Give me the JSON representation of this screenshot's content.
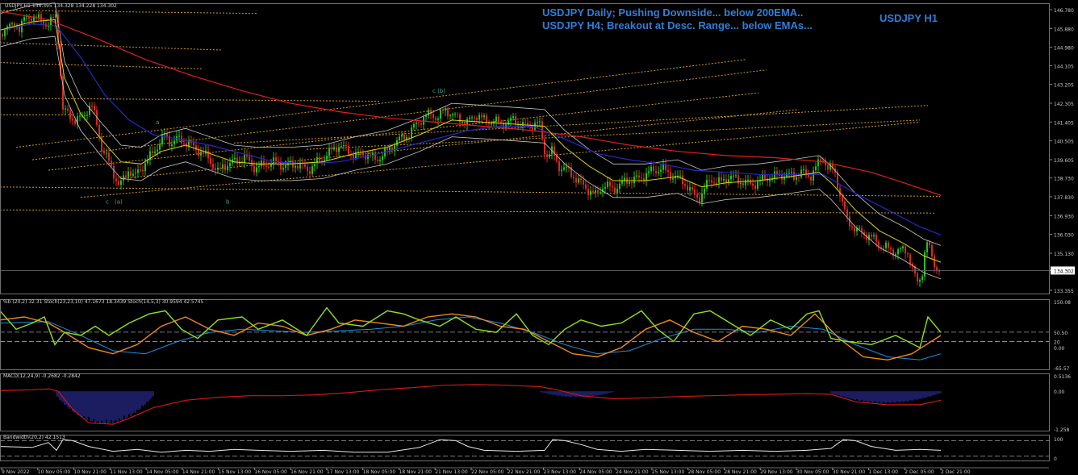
{
  "header": {
    "headline_1": "USDJPY Daily; Pushing Downside... below 200EMA..",
    "headline_2": "USDJPY H4; Breakout at Desc. Range... below EMAs...",
    "symbol_title": "USDJPY H1"
  },
  "panes": {
    "main_info": "USDJPY,H1  134.395 134.328 134.228 134.302",
    "osc_info": "%b (20,2) 32.31  Stoch(23,23,10) 47.1673 18.3439  Stoch(14,5,3) 30.9594 42.5745",
    "macd_info": "MACD(12,24,9) -0.2682 -0.2842",
    "bw_info": "Bandwidth(20,2) 42.1513"
  },
  "colors": {
    "background": "#000000",
    "bull_candle": "#22c11a",
    "bear_candle": "#d42b1f",
    "ema200": "#e02020",
    "ema_blue": "#2828c8",
    "ema_yellow": "#d8d020",
    "bands": "#c8c8c8",
    "fib_lines": "#d09a1c",
    "lime": "#90e020",
    "orange": "#f08820",
    "osc_blue": "#2090e0",
    "macd_line": "#d01818",
    "macd_hist": "#3838c0",
    "wave_labels": "#30b0a0",
    "axis_text": "#c8c8c8",
    "current_price_bg": "#ffffff"
  },
  "chart_data": [
    {
      "type": "candlestick",
      "title": "USDJPY H1",
      "x_tick_labels": [
        "9 Nov 2022",
        "10 Nov 05:00",
        "10 Nov 21:00",
        "11 Nov 13:00",
        "14 Nov 05:00",
        "14 Nov 21:00",
        "15 Nov 13:00",
        "16 Nov 05:00",
        "16 Nov 21:00",
        "17 Nov 13:00",
        "18 Nov 05:00",
        "18 Nov 21:00",
        "21 Nov 13:00",
        "22 Nov 05:00",
        "22 Nov 21:00",
        "23 Nov 13:00",
        "24 Nov 05:00",
        "24 Nov 21:00",
        "25 Nov 13:00",
        "28 Nov 05:00",
        "28 Nov 21:00",
        "29 Nov 13:00",
        "30 Nov 05:00",
        "30 Nov 21:00",
        "1 Dec 13:00",
        "2 Dec 05:00",
        "2 Dec 21:00"
      ],
      "y_tick_labels": [
        "146.780",
        "145.880",
        "144.980",
        "144.105",
        "143.205",
        "142.305",
        "141.405",
        "140.505",
        "139.605",
        "138.730",
        "137.830",
        "136.930",
        "136.030",
        "135.130",
        "134.302",
        "133.355"
      ],
      "ylim": [
        133.355,
        146.78
      ],
      "current_price": 134.302,
      "price_path": {
        "x": [
          0,
          8,
          14,
          20,
          24,
          30,
          40,
          48,
          60,
          70,
          78,
          92,
          102,
          113,
          122,
          126,
          136,
          148,
          160,
          166,
          172,
          182,
          190,
          200,
          204,
          212,
          220,
          232,
          244,
          258,
          270,
          276,
          290,
          304,
          316,
          340,
          352,
          368,
          382,
          400,
          410,
          420,
          432,
          440,
          452,
          466,
          480,
          492,
          506,
          516,
          524,
          534,
          542,
          552,
          566,
          580,
          592,
          602,
          612,
          620,
          636,
          652,
          668,
          676,
          684,
          692,
          704,
          716,
          728,
          738,
          748,
          760,
          776,
          792,
          804,
          820,
          830,
          846,
          860,
          868,
          880,
          892,
          904,
          916,
          932,
          948,
          960,
          972,
          984,
          994,
          1004,
          1012,
          1020,
          1026,
          1034,
          1042,
          1050,
          1062,
          1076,
          1092,
          1108,
          1124,
          1136,
          1142,
          1148,
          1154,
          1160,
          1166
        ],
        "y": [
          145.6,
          146.0,
          145.9,
          146.2,
          145.9,
          146.3,
          146.5,
          146.3,
          146.1,
          146.5,
          142.0,
          141.5,
          141.6,
          142.3,
          141.0,
          140.2,
          139.4,
          138.3,
          139.2,
          138.7,
          139.1,
          139.5,
          140.0,
          140.5,
          140.8,
          140.4,
          140.6,
          140.4,
          140.1,
          139.7,
          139.0,
          139.3,
          139.5,
          139.7,
          139.2,
          139.5,
          139.3,
          139.4,
          139.1,
          139.7,
          140.0,
          140.3,
          140.0,
          139.8,
          139.9,
          139.6,
          140.0,
          140.5,
          140.8,
          141.3,
          141.6,
          141.8,
          141.6,
          142.0,
          141.6,
          141.4,
          141.8,
          141.4,
          141.5,
          141.3,
          141.5,
          141.2,
          141.4,
          139.8,
          140.0,
          139.3,
          139.1,
          138.6,
          138.2,
          137.9,
          138.4,
          138.2,
          138.6,
          138.7,
          139.0,
          139.2,
          138.9,
          138.6,
          137.9,
          137.8,
          138.7,
          138.5,
          138.8,
          138.6,
          138.4,
          138.7,
          138.8,
          138.9,
          138.8,
          139.0,
          138.8,
          139.3,
          139.7,
          139.2,
          139.1,
          137.8,
          136.7,
          136.2,
          136.0,
          135.5,
          135.2,
          135.3,
          133.7,
          134.0,
          135.7,
          135.1,
          134.4,
          134.3
        ]
      },
      "ema200": {
        "x": [
          0,
          60,
          120,
          180,
          240,
          300,
          360,
          420,
          480,
          540,
          600,
          660,
          720,
          780,
          840,
          900,
          960,
          1020,
          1080,
          1120,
          1166
        ],
        "y": [
          146.7,
          146.3,
          145.4,
          144.4,
          143.6,
          142.9,
          142.3,
          141.9,
          141.6,
          141.4,
          141.2,
          141.0,
          140.7,
          140.3,
          140.0,
          139.8,
          139.7,
          139.5,
          139.0,
          138.5,
          137.9
        ]
      },
      "ema_blue": {
        "x": [
          0,
          40,
          70,
          100,
          130,
          160,
          190,
          220,
          260,
          300,
          340,
          380,
          420,
          460,
          500,
          540,
          580,
          620,
          660,
          700,
          740,
          780,
          820,
          860,
          900,
          940,
          980,
          1020,
          1060,
          1100,
          1140,
          1166
        ],
        "y": [
          145.8,
          146.1,
          146.0,
          144.5,
          142.7,
          141.5,
          140.8,
          140.6,
          140.3,
          139.9,
          139.5,
          139.4,
          139.5,
          139.8,
          140.2,
          140.6,
          141.0,
          141.2,
          141.2,
          140.6,
          139.9,
          139.6,
          139.4,
          139.1,
          139.0,
          138.9,
          138.9,
          138.9,
          138.0,
          137.2,
          136.4,
          136.0
        ]
      },
      "ema_yellow": {
        "x": [
          0,
          40,
          68,
          80,
          100,
          125,
          150,
          175,
          200,
          230,
          260,
          290,
          320,
          360,
          400,
          440,
          480,
          520,
          560,
          600,
          640,
          675,
          700,
          730,
          760,
          800,
          840,
          870,
          900,
          940,
          980,
          1015,
          1030,
          1060,
          1090,
          1120,
          1145,
          1166
        ],
        "y": [
          145.8,
          146.2,
          146.3,
          143.5,
          141.8,
          140.6,
          139.5,
          139.4,
          140.0,
          140.3,
          139.9,
          139.5,
          139.4,
          139.4,
          139.5,
          139.9,
          140.2,
          140.8,
          141.5,
          141.4,
          141.3,
          141.2,
          140.2,
          139.3,
          138.6,
          138.6,
          138.8,
          138.3,
          138.5,
          138.6,
          138.8,
          139.0,
          138.5,
          137.2,
          136.2,
          135.6,
          135.0,
          134.7
        ]
      },
      "fib_levels": [
        {
          "x1": 0,
          "y1": 146.75,
          "x2": 320,
          "y2": 146.6
        },
        {
          "x1": 0,
          "y1": 145.2,
          "x2": 275,
          "y2": 144.85
        },
        {
          "x1": 0,
          "y1": 144.25,
          "x2": 250,
          "y2": 143.95
        },
        {
          "x1": 0,
          "y1": 142.55,
          "x2": 470,
          "y2": 142.4
        },
        {
          "x1": 0,
          "y1": 141.75,
          "x2": 90,
          "y2": 141.75
        },
        {
          "x1": 0,
          "y1": 138.3,
          "x2": 1165,
          "y2": 137.85
        },
        {
          "x1": 0,
          "y1": 137.2,
          "x2": 1160,
          "y2": 137.05
        },
        {
          "x1": 20,
          "y1": 140.2,
          "x2": 925,
          "y2": 144.4
        },
        {
          "x1": 40,
          "y1": 139.6,
          "x2": 950,
          "y2": 143.9
        },
        {
          "x1": 60,
          "y1": 139.1,
          "x2": 940,
          "y2": 142.8
        },
        {
          "x1": 100,
          "y1": 137.8,
          "x2": 1140,
          "y2": 141.4
        },
        {
          "x1": 150,
          "y1": 138.7,
          "x2": 990,
          "y2": 142.0
        },
        {
          "x1": 290,
          "y1": 140.4,
          "x2": 1150,
          "y2": 142.2
        },
        {
          "x1": 380,
          "y1": 140.1,
          "x2": 1140,
          "y2": 141.5
        }
      ],
      "wave_labels": [
        {
          "text": "a",
          "x": 193,
          "y": 141.3
        },
        {
          "text": "c (b)",
          "x": 536,
          "y": 142.8
        },
        {
          "text": "c",
          "x": 131,
          "y": 137.5
        },
        {
          "text": "(a)",
          "x": 142,
          "y": 137.5
        },
        {
          "text": "b",
          "x": 280,
          "y": 137.5
        }
      ]
    },
    {
      "type": "line",
      "title": "%b (20,2) / Stochastics",
      "y_tick_labels": [
        "150.08",
        "50.50",
        "20",
        "0.00",
        "-65.57"
      ],
      "ylim": [
        -65.57,
        150.08
      ],
      "levels": [
        50.5,
        20
      ],
      "lime": {
        "x": [
          0,
          20,
          40,
          55,
          68,
          80,
          100,
          118,
          135,
          160,
          185,
          205,
          225,
          245,
          270,
          300,
          320,
          350,
          380,
          405,
          420,
          450,
          480,
          500,
          520,
          545,
          565,
          590,
          615,
          640,
          660,
          680,
          700,
          720,
          745,
          770,
          795,
          815,
          835,
          860,
          880,
          905,
          930,
          955,
          980,
          1000,
          1015,
          1030,
          1050,
          1080,
          1110,
          1140,
          1150,
          1166
        ],
        "y": [
          120,
          60,
          80,
          100,
          10,
          50,
          40,
          70,
          40,
          80,
          110,
          120,
          60,
          30,
          90,
          100,
          60,
          90,
          40,
          130,
          80,
          70,
          120,
          110,
          90,
          70,
          100,
          60,
          50,
          110,
          40,
          10,
          60,
          90,
          70,
          80,
          120,
          60,
          20,
          110,
          120,
          80,
          40,
          90,
          60,
          110,
          120,
          30,
          20,
          10,
          40,
          0,
          100,
          50
        ]
      },
      "orange": {
        "x": [
          0,
          30,
          60,
          80,
          110,
          140,
          170,
          200,
          230,
          260,
          290,
          320,
          350,
          380,
          410,
          440,
          470,
          500,
          530,
          560,
          590,
          620,
          650,
          680,
          710,
          740,
          770,
          800,
          830,
          860,
          890,
          920,
          950,
          980,
          1010,
          1040,
          1070,
          1100,
          1130,
          1166
        ],
        "y": [
          90,
          100,
          80,
          50,
          0,
          -20,
          10,
          70,
          100,
          60,
          40,
          80,
          70,
          40,
          60,
          90,
          80,
          70,
          100,
          110,
          100,
          70,
          60,
          20,
          -20,
          -30,
          0,
          60,
          90,
          50,
          20,
          70,
          60,
          40,
          110,
          30,
          -30,
          -40,
          -20,
          40
        ]
      },
      "blue": {
        "x": [
          0,
          60,
          100,
          140,
          180,
          220,
          260,
          300,
          340,
          380,
          420,
          460,
          500,
          540,
          580,
          620,
          660,
          700,
          740,
          780,
          820,
          860,
          900,
          940,
          980,
          1020,
          1060,
          1100,
          1140,
          1166
        ],
        "y": [
          80,
          85,
          40,
          -10,
          -20,
          20,
          50,
          60,
          55,
          50,
          55,
          60,
          70,
          90,
          100,
          80,
          50,
          10,
          -20,
          -10,
          30,
          60,
          60,
          50,
          70,
          60,
          10,
          -30,
          -40,
          -20
        ]
      }
    },
    {
      "type": "bar",
      "title": "MACD(12,24,9)",
      "y_tick_labels": [
        "0.5136",
        "0.00",
        "-1.258"
      ],
      "ylim": [
        -1.258,
        0.5136
      ],
      "macd_line": {
        "x": [
          0,
          40,
          60,
          72,
          90,
          110,
          140,
          160,
          190,
          230,
          270,
          310,
          350,
          390,
          430,
          470,
          510,
          550,
          590,
          630,
          670,
          690,
          720,
          760,
          800,
          840,
          880,
          920,
          960,
          1000,
          1030,
          1060,
          1100,
          1140,
          1166
        ],
        "y": [
          0.02,
          0.05,
          0.08,
          0.0,
          -0.6,
          -1.05,
          -1.1,
          -0.9,
          -0.55,
          -0.3,
          -0.2,
          -0.15,
          -0.15,
          -0.12,
          -0.05,
          0.05,
          0.12,
          0.2,
          0.22,
          0.2,
          0.15,
          0.05,
          -0.15,
          -0.25,
          -0.22,
          -0.18,
          -0.15,
          -0.12,
          -0.1,
          -0.08,
          -0.1,
          -0.35,
          -0.45,
          -0.45,
          -0.3
        ]
      },
      "hist_segments": [
        {
          "x1": 70,
          "x2": 190,
          "min": -1.1,
          "amp": 0.55
        },
        {
          "x1": 670,
          "x2": 760,
          "min": -0.25,
          "amp": 0.1
        },
        {
          "x1": 1030,
          "x2": 1166,
          "min": -0.45,
          "amp": 0.2
        }
      ]
    },
    {
      "type": "line",
      "title": "Bandwidth(20,2)",
      "y_tick_labels": [
        "100",
        "0"
      ],
      "ylim": [
        0,
        100
      ],
      "levels": [
        90,
        10
      ],
      "values": {
        "x": [
          0,
          40,
          60,
          70,
          78,
          90,
          110,
          140,
          170,
          200,
          230,
          260,
          290,
          320,
          360,
          400,
          440,
          480,
          520,
          545,
          565,
          580,
          600,
          640,
          675,
          685,
          700,
          720,
          740,
          770,
          800,
          840,
          880,
          920,
          960,
          1000,
          1030,
          1045,
          1060,
          1080,
          1110,
          1140,
          1166
        ],
        "y": [
          60,
          55,
          80,
          40,
          95,
          90,
          60,
          35,
          45,
          30,
          40,
          35,
          45,
          40,
          35,
          40,
          30,
          30,
          55,
          95,
          90,
          60,
          40,
          35,
          40,
          95,
          90,
          70,
          45,
          35,
          45,
          40,
          35,
          40,
          35,
          40,
          50,
          95,
          90,
          60,
          40,
          45,
          40
        ]
      }
    }
  ]
}
